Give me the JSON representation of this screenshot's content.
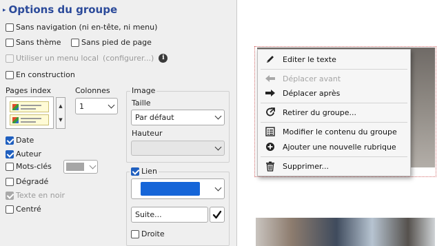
{
  "panel": {
    "title": "Options du groupe",
    "options": {
      "no_nav": "Sans navigation (ni en-tête, ni menu)",
      "no_theme": "Sans thème",
      "no_footer": "Sans pied de page",
      "local_menu": "Utiliser un menu local",
      "local_menu_config": "(configurer...)",
      "under_construction": "En construction"
    },
    "pages_index_label": "Pages index",
    "columns_label": "Colonnes",
    "columns_value": "1",
    "checks": {
      "date": "Date",
      "author": "Auteur",
      "keywords": "Mots-clés",
      "gradient": "Dégradé",
      "black_text": "Texte en noir",
      "centered": "Centré"
    },
    "image": {
      "legend": "Image",
      "size_label": "Taille",
      "size_value": "Par défaut",
      "height_label": "Hauteur",
      "height_value": ""
    },
    "link": {
      "legend": "Lien",
      "color": "#1565d8",
      "suite_value": "Suite...",
      "right_label": "Droite"
    },
    "keywords_color": "#a6a6a6"
  },
  "context_menu": {
    "items": [
      {
        "label": "Editer le texte",
        "icon": "pencil-icon",
        "enabled": true
      },
      {
        "label": "Déplacer avant",
        "icon": "arrow-left-icon",
        "enabled": false
      },
      {
        "label": "Déplacer après",
        "icon": "arrow-right-icon",
        "enabled": true
      },
      {
        "label": "Retirer du groupe...",
        "icon": "share-out-icon",
        "enabled": true
      },
      {
        "label": "Modifier le contenu du groupe",
        "icon": "list-icon",
        "enabled": true
      },
      {
        "label": "Ajouter une nouvelle rubrique",
        "icon": "plus-circle-icon",
        "enabled": true
      },
      {
        "label": "Supprimer...",
        "icon": "trash-icon",
        "enabled": true
      }
    ]
  },
  "colors": {
    "accent": "#1f5fbf",
    "title": "#2b4a9a",
    "selection_frame": "#d46a6a"
  }
}
